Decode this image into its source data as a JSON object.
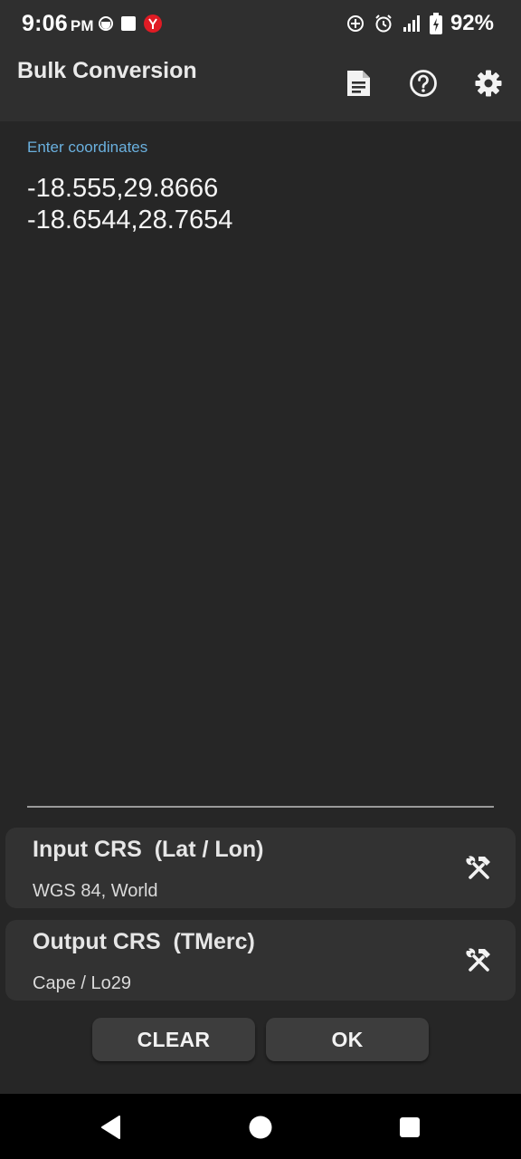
{
  "status_bar": {
    "time": "9:06",
    "ampm": "PM",
    "battery": "92%",
    "left_icons": [
      "data-saver-icon",
      "square-notification-icon",
      "app-notification-icon"
    ],
    "right_icons": [
      "location-target-icon",
      "alarm-icon",
      "signal-icon",
      "battery-icon"
    ]
  },
  "app_bar": {
    "title": "Bulk Conversion",
    "actions": [
      "document-icon",
      "help-icon",
      "settings-icon"
    ]
  },
  "editor": {
    "label": "Enter coordinates",
    "value": "-18.555,29.8666\n-18.6544,28.7654"
  },
  "input_crs": {
    "title": "Input CRS  (Lat / Lon)",
    "subtitle": "WGS 84, World",
    "icon": "tools-icon"
  },
  "output_crs": {
    "title": "Output CRS  (TMerc)",
    "subtitle": "Cape / Lo29",
    "icon": "tools-icon"
  },
  "buttons": {
    "clear": "CLEAR",
    "ok": "OK"
  },
  "colors": {
    "background": "#262626",
    "bar": "#2f2f2f",
    "card": "#323232",
    "accent_label": "#6ab0de",
    "nav_bar": "#000000"
  }
}
